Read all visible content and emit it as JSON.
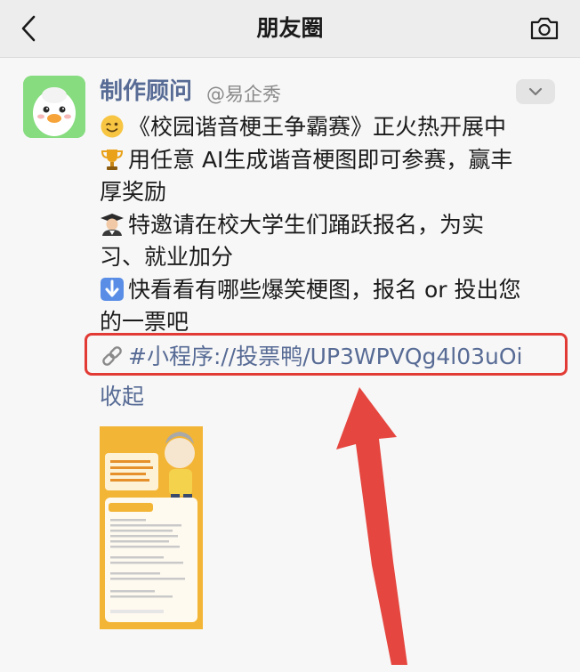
{
  "nav": {
    "back_icon": "chevron-left-icon",
    "title": "朋友圈",
    "camera_icon": "camera-icon"
  },
  "post": {
    "author": "制作顾问",
    "handle": "@易企秀",
    "lines": [
      "《校园谐音梗王争霸赛》正火热开展中",
      "用任意 AI生成谐音梗图即可参赛，赢丰",
      "厚奖励",
      "特邀请在校大学生们踊跃报名，为实",
      "习、就业加分",
      "快看看有哪些爆笑梗图，报名 or 投出您",
      "的一票吧"
    ],
    "emojis": [
      "wink-emoji",
      "trophy-emoji",
      "student-emoji",
      "down-arrow-emoji"
    ],
    "link_text": "#小程序://投票鸭/UP3WPVQg4l03uOi",
    "link_icon": "link-icon",
    "collapse_label": "收起",
    "more_icon": "chevron-down-icon",
    "image_alt": "poster-thumbnail"
  },
  "colors": {
    "link": "#576b95",
    "highlight": "#e23b35",
    "arrow": "#e5463f",
    "nav_bg": "#ededed"
  }
}
